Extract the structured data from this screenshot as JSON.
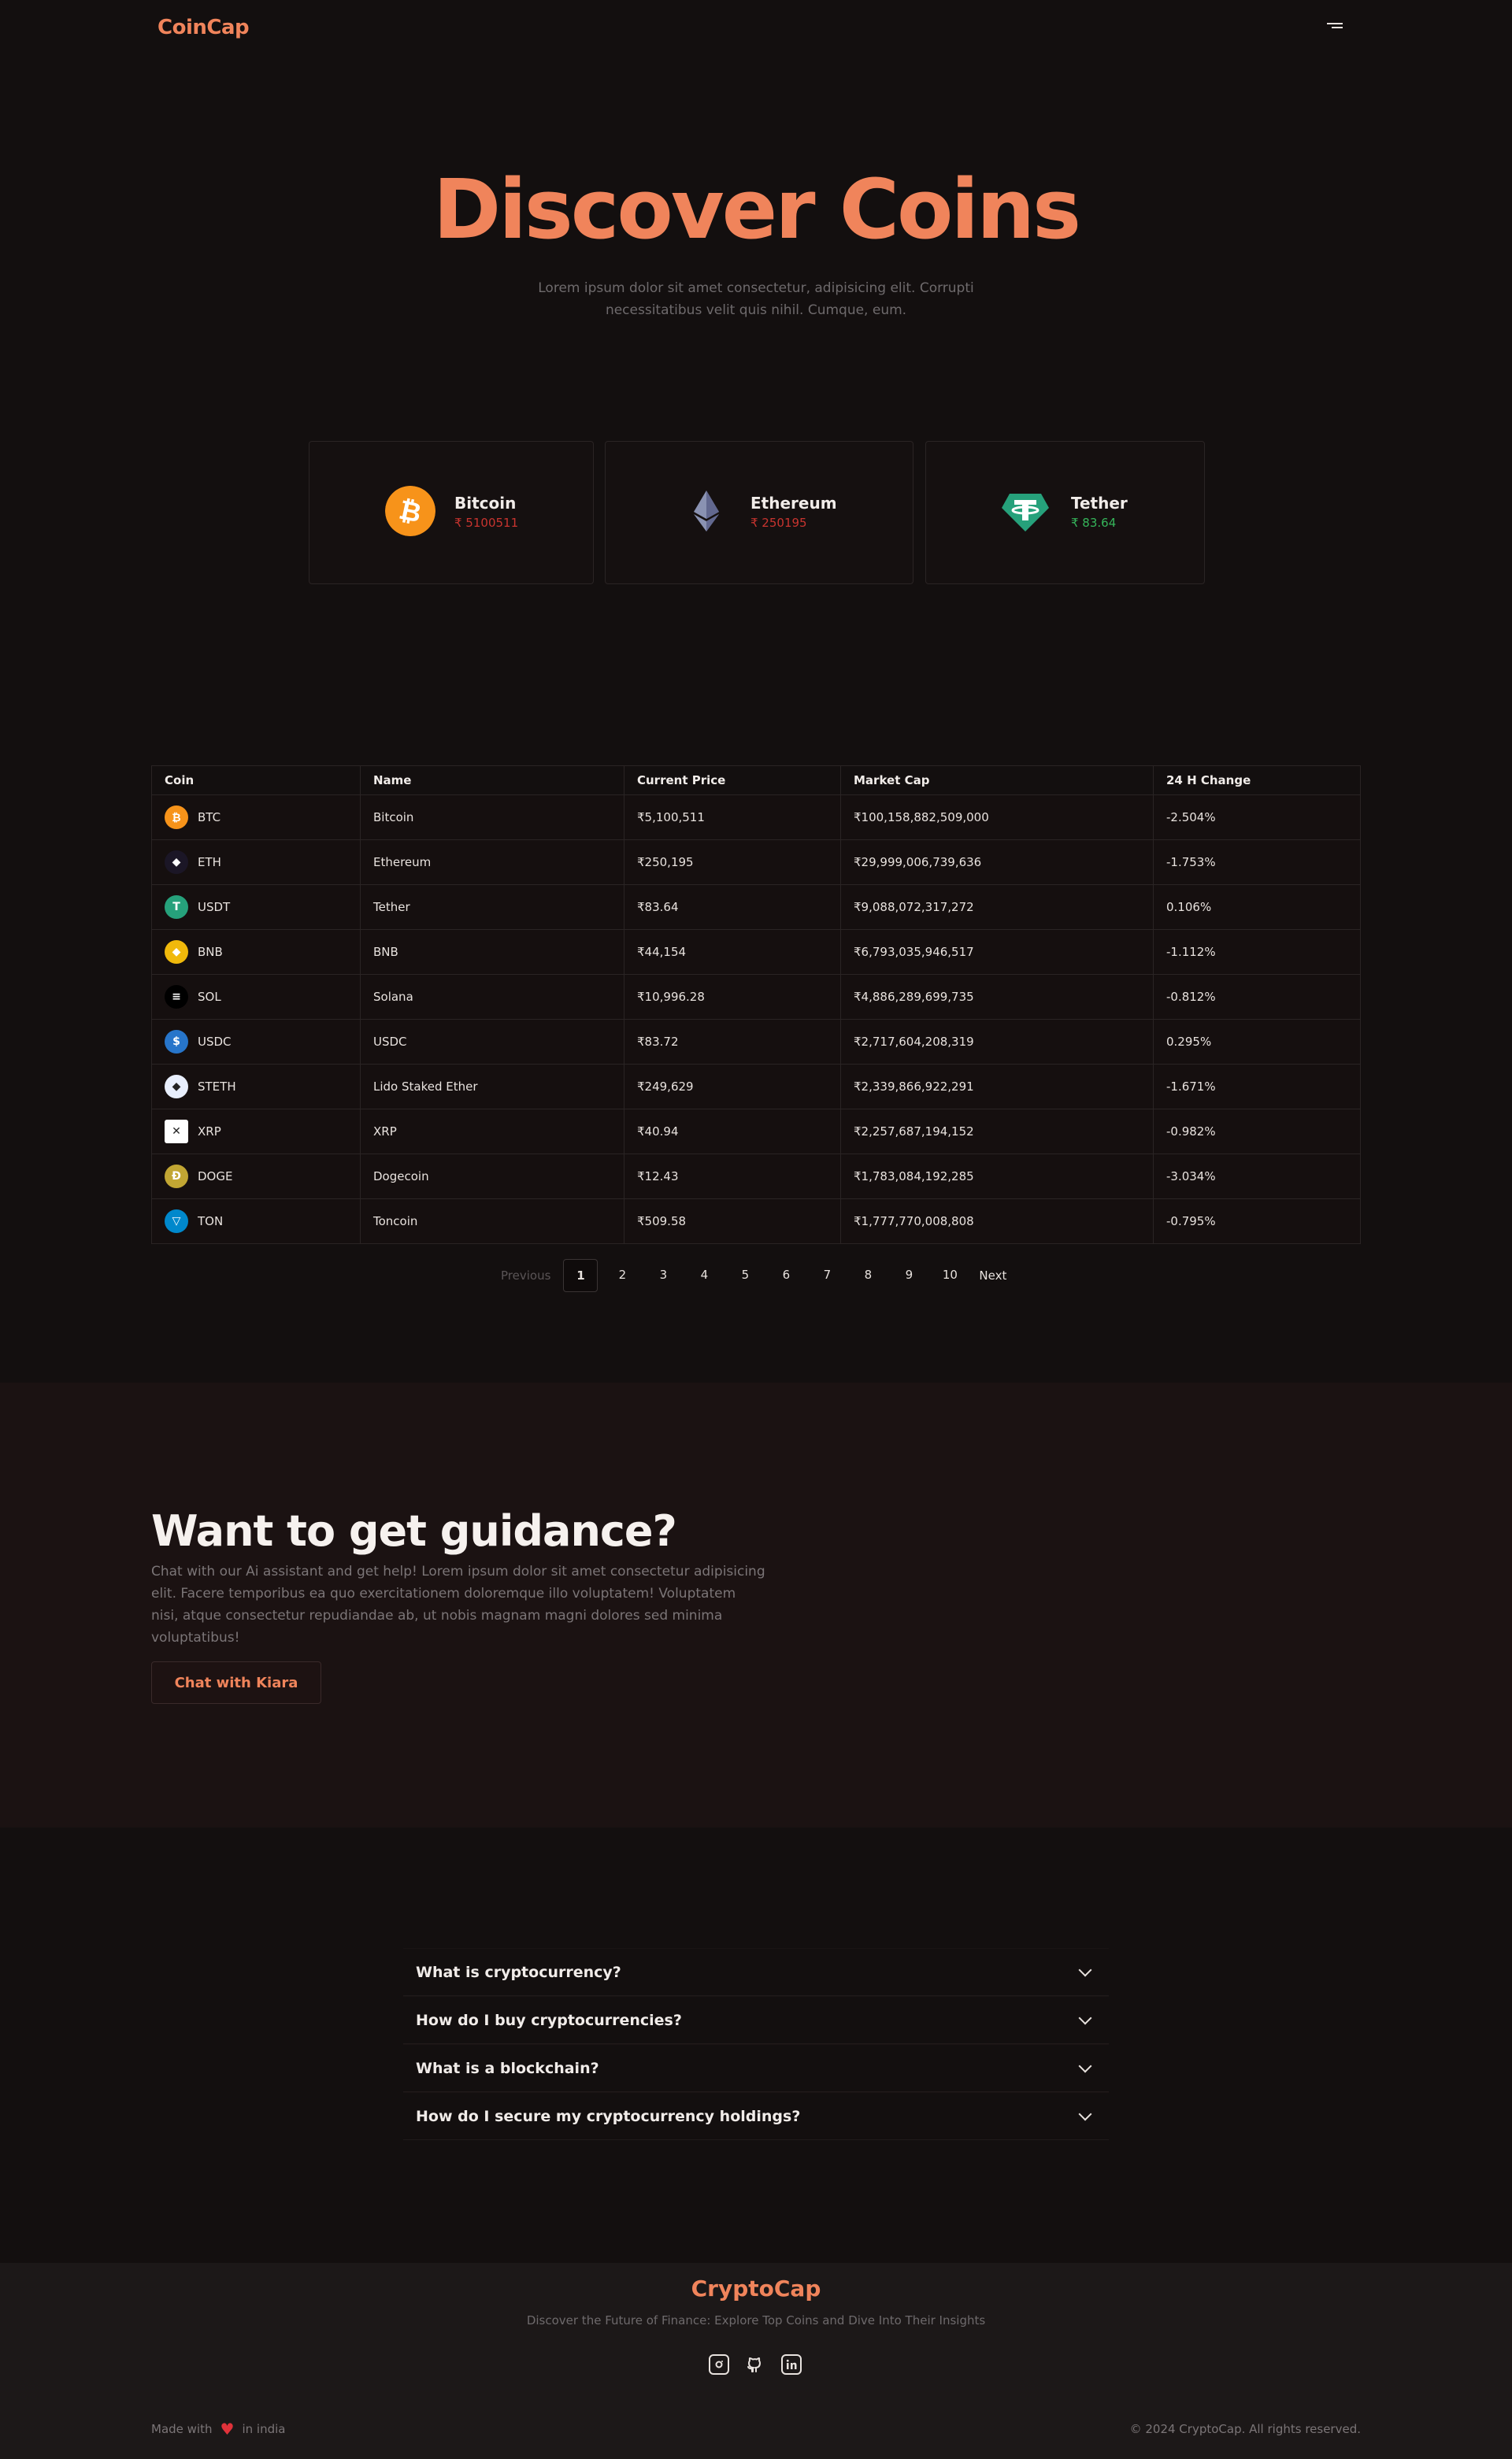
{
  "header": {
    "logo": "CoinCap"
  },
  "hero": {
    "title": "Discover Coins",
    "subtitle": "Lorem ipsum dolor sit amet consectetur, adipisicing elit. Corrupti necessitatibus velit quis nihil. Cumque, eum."
  },
  "cards": [
    {
      "name": "Bitcoin",
      "price": "₹ 5100511",
      "trend": "neg",
      "color": "#f7931a"
    },
    {
      "name": "Ethereum",
      "price": "₹ 250195",
      "trend": "neg",
      "color": "#627eea"
    },
    {
      "name": "Tether",
      "price": "₹ 83.64",
      "trend": "pos",
      "color": "#26a17b"
    }
  ],
  "table": {
    "headers": [
      "Coin",
      "Name",
      "Current Price",
      "Market Cap",
      "24 H Change"
    ],
    "rows": [
      {
        "symbol": "BTC",
        "name": "Bitcoin",
        "price": "₹5,100,511",
        "cap": "₹100,158,882,509,000",
        "change": "-2.504%",
        "trend": "neg",
        "icon": "bitcoin-icon",
        "color": "#f7931a",
        "glyph": "₿"
      },
      {
        "symbol": "ETH",
        "name": "Ethereum",
        "price": "₹250,195",
        "cap": "₹29,999,006,739,636",
        "change": "-1.753%",
        "trend": "neg",
        "icon": "ethereum-icon",
        "color": "#1b1626",
        "glyph": "◆"
      },
      {
        "symbol": "USDT",
        "name": "Tether",
        "price": "₹83.64",
        "cap": "₹9,088,072,317,272",
        "change": "0.106%",
        "trend": "pos",
        "icon": "tether-icon",
        "color": "#26a17b",
        "glyph": "T"
      },
      {
        "symbol": "BNB",
        "name": "BNB",
        "price": "₹44,154",
        "cap": "₹6,793,035,946,517",
        "change": "-1.112%",
        "trend": "neg",
        "icon": "bnb-icon",
        "color": "#f0b90b",
        "glyph": "◆"
      },
      {
        "symbol": "SOL",
        "name": "Solana",
        "price": "₹10,996.28",
        "cap": "₹4,886,289,699,735",
        "change": "-0.812%",
        "trend": "neg",
        "icon": "solana-icon",
        "color": "#000000",
        "glyph": "≡"
      },
      {
        "symbol": "USDC",
        "name": "USDC",
        "price": "₹83.72",
        "cap": "₹2,717,604,208,319",
        "change": "0.295%",
        "trend": "pos",
        "icon": "usdc-icon",
        "color": "#2775ca",
        "glyph": "$"
      },
      {
        "symbol": "STETH",
        "name": "Lido Staked Ether",
        "price": "₹249,629",
        "cap": "₹2,339,866,922,291",
        "change": "-1.671%",
        "trend": "neg",
        "icon": "steth-icon",
        "color": "#e8eefc",
        "glyph": "◆"
      },
      {
        "symbol": "XRP",
        "name": "XRP",
        "price": "₹40.94",
        "cap": "₹2,257,687,194,152",
        "change": "-0.982%",
        "trend": "neg",
        "icon": "xrp-icon",
        "color": "#ffffff",
        "glyph": "✕"
      },
      {
        "symbol": "DOGE",
        "name": "Dogecoin",
        "price": "₹12.43",
        "cap": "₹1,783,084,192,285",
        "change": "-3.034%",
        "trend": "neg",
        "icon": "dogecoin-icon",
        "color": "#c2a633",
        "glyph": "Ð"
      },
      {
        "symbol": "TON",
        "name": "Toncoin",
        "price": "₹509.58",
        "cap": "₹1,777,770,008,808",
        "change": "-0.795%",
        "trend": "neg",
        "icon": "toncoin-icon",
        "color": "#0088cc",
        "glyph": "▽"
      }
    ]
  },
  "pagination": {
    "prev": "Previous",
    "next": "Next",
    "pages": [
      "1",
      "2",
      "3",
      "4",
      "5",
      "6",
      "7",
      "8",
      "9",
      "10"
    ],
    "current": "1"
  },
  "guidance": {
    "title": "Want to get guidance?",
    "text": "Chat with our Ai assistant and get help! Lorem ipsum dolor sit amet consectetur adipisicing elit. Facere temporibus ea quo exercitationem doloremque illo voluptatem! Voluptatem nisi, atque consectetur repudiandae ab, ut nobis magnam magni dolores sed minima voluptatibus!",
    "button": "Chat with Kiara"
  },
  "faq": [
    "What is cryptocurrency?",
    "How do I buy cryptocurrencies?",
    "What is a blockchain?",
    "How do I secure my cryptocurrency holdings?"
  ],
  "footer": {
    "logo": "CryptoCap",
    "tagline": "Discover the Future of Finance: Explore Top Coins and Dive Into Their Insights",
    "made_prefix": "Made with",
    "made_suffix": "in india",
    "copyright": "© 2024 CryptoCap. All rights reserved.",
    "socials": [
      "instagram-icon",
      "github-icon",
      "linkedin-icon"
    ]
  },
  "colors": {
    "accent": "#f0845b",
    "negative": "#c8342f",
    "positive": "#35b55a"
  }
}
